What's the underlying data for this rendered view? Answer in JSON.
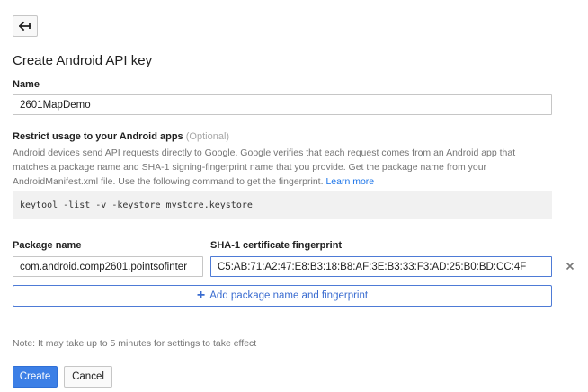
{
  "page": {
    "title": "Create Android API key",
    "back_icon": "arrow-left-icon"
  },
  "name_field": {
    "label": "Name",
    "value": "2601MapDemo"
  },
  "restrict": {
    "label": "Restrict usage to your Android apps",
    "optional": "(Optional)",
    "help_text": "Android devices send API requests directly to Google. Google verifies that each request comes from an Android app that matches a package name and SHA-1 signing-fingerprint name that you provide. Get the package name from your AndroidManifest.xml file. Use the following command to get the fingerprint.",
    "learn_more": "Learn more",
    "command": "keytool -list -v -keystore mystore.keystore"
  },
  "package": {
    "label": "Package name",
    "value": "com.android.comp2601.pointsofinter"
  },
  "fingerprint": {
    "label": "SHA-1 certificate fingerprint",
    "value": "C5:AB:71:A2:47:E8:B3:18:B8:AF:3E:B3:33:F3:AD:25:B0:BD:CC:4F"
  },
  "add_button": {
    "label": "Add package name and fingerprint",
    "icon": "plus-icon"
  },
  "remove_icon": "close-icon",
  "note": "Note: It may take up to 5 minutes for settings to take effect",
  "actions": {
    "create": "Create",
    "cancel": "Cancel"
  },
  "colors": {
    "accent": "#3c7fe6",
    "link": "#1a73e8"
  }
}
